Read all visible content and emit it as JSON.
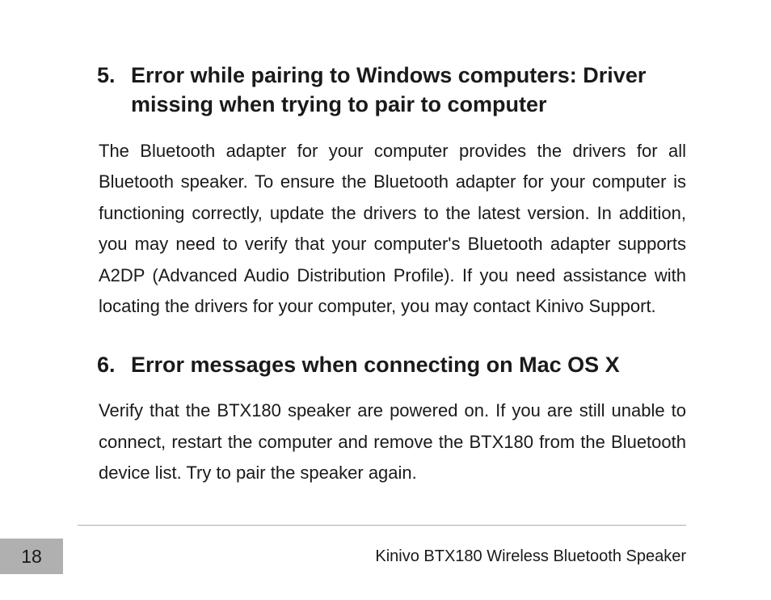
{
  "sections": [
    {
      "number": "5.",
      "title": "Error while pairing to Windows computers: Driver missing when trying to pair to computer",
      "body": "The Bluetooth adapter for your computer provides the drivers for all Bluetooth speaker. To ensure the Bluetooth adapter for your computer is functioning correctly, update the drivers to the latest version. In addition, you may need to verify that your computer's Bluetooth adapter supports A2DP (Advanced Audio Distribution Profile). If you need assistance with locating the drivers for your computer, you may contact Kinivo Support."
    },
    {
      "number": "6.",
      "title": "Error messages when connecting on Mac OS X",
      "body": "Verify that the BTX180 speaker are powered on. If you are still unable to connect, restart the computer and remove the BTX180 from the Bluetooth device list. Try to pair the speaker again."
    }
  ],
  "footer": {
    "page_number": "18",
    "doc_title": "Kinivo BTX180 Wireless Bluetooth Speaker"
  }
}
